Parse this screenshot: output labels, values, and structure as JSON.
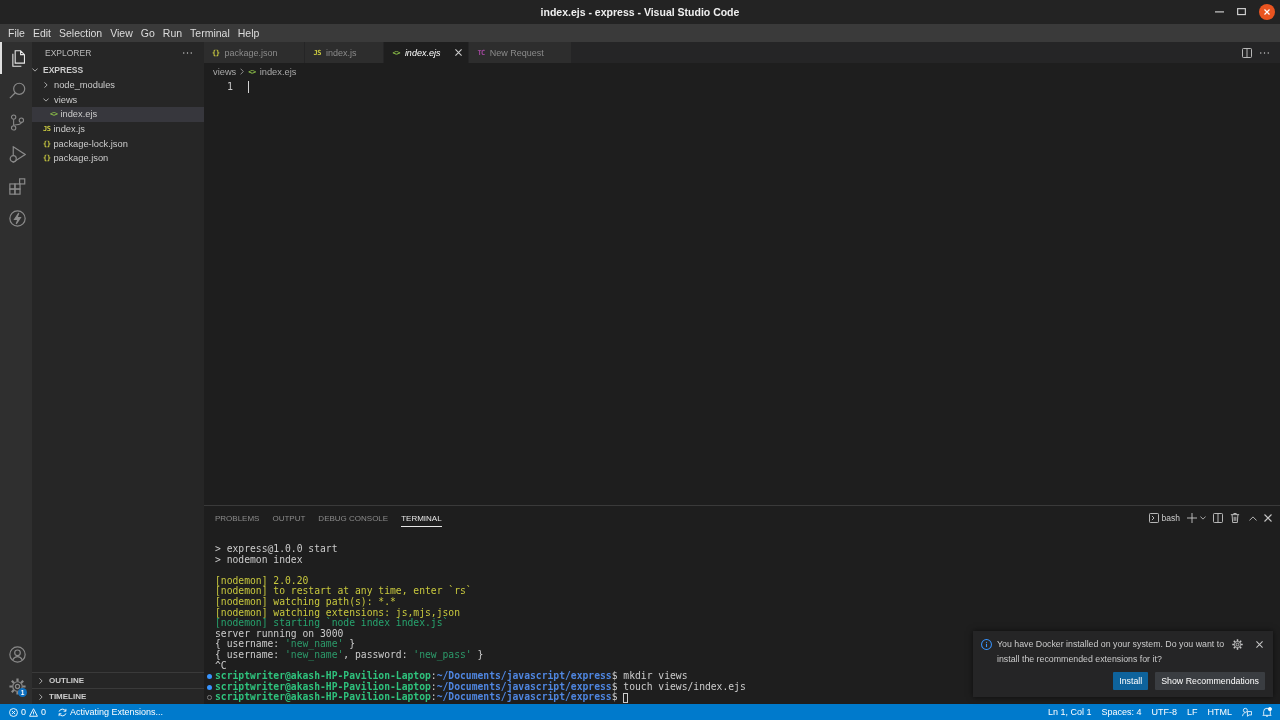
{
  "window": {
    "title": "index.ejs - express - Visual Studio Code"
  },
  "menu": [
    "File",
    "Edit",
    "Selection",
    "View",
    "Go",
    "Run",
    "Terminal",
    "Help"
  ],
  "activity_bar": {
    "items": [
      {
        "kind": "files",
        "selected": true
      },
      {
        "kind": "search",
        "selected": false
      },
      {
        "kind": "source_control",
        "selected": false
      },
      {
        "kind": "run_debug",
        "selected": false
      },
      {
        "kind": "extensions",
        "selected": false
      },
      {
        "kind": "lightning",
        "selected": false
      }
    ],
    "bottom_items": [
      {
        "kind": "account"
      },
      {
        "kind": "settings",
        "badge": "1"
      }
    ]
  },
  "sidebar": {
    "title": "EXPLORER",
    "root": {
      "label": "EXPRESS",
      "expanded": true,
      "children": [
        {
          "label": "node_modules",
          "kind": "folder",
          "expanded": false,
          "selected": false
        },
        {
          "label": "views",
          "kind": "folder",
          "expanded": true,
          "selected": false,
          "children": [
            {
              "label": "index.ejs",
              "kind": "ejs",
              "glyph": "<>",
              "selected": true
            }
          ]
        },
        {
          "label": "index.js",
          "kind": "js",
          "glyph": "JS",
          "selected": false
        },
        {
          "label": "package-lock.json",
          "kind": "json",
          "glyph": "{}",
          "selected": false
        },
        {
          "label": "package.json",
          "kind": "json",
          "glyph": "{}",
          "selected": false
        }
      ]
    },
    "sections": [
      {
        "label": "OUTLINE",
        "expanded": false
      },
      {
        "label": "TIMELINE",
        "expanded": false
      }
    ]
  },
  "editor": {
    "tabs": [
      {
        "label": "package.json",
        "kind": "json",
        "glyph": "{}",
        "selected": false,
        "preview": false
      },
      {
        "label": "index.js",
        "kind": "js",
        "glyph": "JS",
        "selected": false,
        "preview": false
      },
      {
        "label": "index.ejs",
        "kind": "ejs",
        "glyph": "<>",
        "selected": true,
        "preview": true
      },
      {
        "label": "New Request",
        "kind": "tc",
        "glyph": "TC",
        "selected": false,
        "preview": false
      }
    ],
    "breadcrumbs": [
      {
        "label": "views"
      },
      {
        "label": "index.ejs",
        "kind": "ejs",
        "glyph": "<>"
      }
    ],
    "line_numbers": [
      "1"
    ]
  },
  "panel": {
    "tabs": [
      {
        "label": "PROBLEMS",
        "selected": false
      },
      {
        "label": "OUTPUT",
        "selected": false
      },
      {
        "label": "DEBUG CONSOLE",
        "selected": false
      },
      {
        "label": "TERMINAL",
        "selected": true
      }
    ],
    "shell": "bash",
    "terminal": {
      "lines": [
        {
          "kind": "output",
          "spaced": false,
          "segments": [
            {
              "text": "> express@1.0.0 start",
              "kind": "plain"
            }
          ]
        },
        {
          "kind": "output",
          "spaced": false,
          "segments": [
            {
              "text": "> nodemon index",
              "kind": "plain"
            }
          ]
        },
        {
          "kind": "output",
          "spaced": true,
          "segments": [
            {
              "text": "[nodemon] 2.0.20",
              "kind": "log"
            }
          ]
        },
        {
          "kind": "output",
          "spaced": false,
          "segments": [
            {
              "text": "[nodemon] to restart at any time, enter `rs`",
              "kind": "log"
            }
          ]
        },
        {
          "kind": "output",
          "spaced": false,
          "segments": [
            {
              "text": "[nodemon] watching path(s): *.*",
              "kind": "log"
            }
          ]
        },
        {
          "kind": "output",
          "spaced": false,
          "segments": [
            {
              "text": "[nodemon] watching extensions: js,mjs,json",
              "kind": "log"
            }
          ]
        },
        {
          "kind": "output",
          "spaced": false,
          "segments": [
            {
              "text": "[nodemon] starting `node index index.js`",
              "kind": "start"
            }
          ]
        },
        {
          "kind": "output",
          "spaced": false,
          "segments": [
            {
              "text": "server running on 3000",
              "kind": "plain"
            }
          ]
        },
        {
          "kind": "output",
          "spaced": false,
          "segments": [
            {
              "text": "{ username: ",
              "kind": "plain"
            },
            {
              "text": "'new_name'",
              "kind": "string"
            },
            {
              "text": " }",
              "kind": "plain"
            }
          ]
        },
        {
          "kind": "output",
          "spaced": false,
          "segments": [
            {
              "text": "{ username: ",
              "kind": "plain"
            },
            {
              "text": "'new_name'",
              "kind": "string"
            },
            {
              "text": ", password: ",
              "kind": "plain"
            },
            {
              "text": "'new_pass'",
              "kind": "string"
            },
            {
              "text": " }",
              "kind": "plain"
            }
          ]
        },
        {
          "kind": "output",
          "spaced": false,
          "segments": [
            {
              "text": "^C",
              "kind": "plain"
            }
          ]
        },
        {
          "kind": "prompt",
          "spaced": false,
          "completed": true,
          "cursor": false,
          "segments": [
            {
              "text": "scriptwriter@akash-HP-Pavilion-Laptop",
              "kind": "user"
            },
            {
              "text": ":",
              "kind": "plain"
            },
            {
              "text": "~/Documents/javascript/express",
              "kind": "path"
            },
            {
              "text": "$ mkdir views",
              "kind": "plain"
            }
          ]
        },
        {
          "kind": "prompt",
          "spaced": false,
          "completed": true,
          "cursor": false,
          "segments": [
            {
              "text": "scriptwriter@akash-HP-Pavilion-Laptop",
              "kind": "user"
            },
            {
              "text": ":",
              "kind": "plain"
            },
            {
              "text": "~/Documents/javascript/express",
              "kind": "path"
            },
            {
              "text": "$ touch views/index.ejs",
              "kind": "plain"
            }
          ]
        },
        {
          "kind": "prompt",
          "spaced": false,
          "completed": false,
          "cursor": true,
          "segments": [
            {
              "text": "scriptwriter@akash-HP-Pavilion-Laptop",
              "kind": "user"
            },
            {
              "text": ":",
              "kind": "plain"
            },
            {
              "text": "~/Documents/javascript/express",
              "kind": "path"
            },
            {
              "text": "$",
              "kind": "plain"
            }
          ]
        }
      ]
    }
  },
  "notification": {
    "message": "You have Docker installed on your system. Do you want to install the recommended extensions for it?",
    "buttons": [
      {
        "label": "Install",
        "kind": "primary"
      },
      {
        "label": "Show Recommendations",
        "kind": "secondary"
      }
    ]
  },
  "status_bar": {
    "errors": "0",
    "warnings": "0",
    "activity": "Activating Extensions...",
    "items": [
      "Ln 1, Col 1",
      "Spaces: 4",
      "UTF-8",
      "LF",
      "HTML"
    ]
  }
}
